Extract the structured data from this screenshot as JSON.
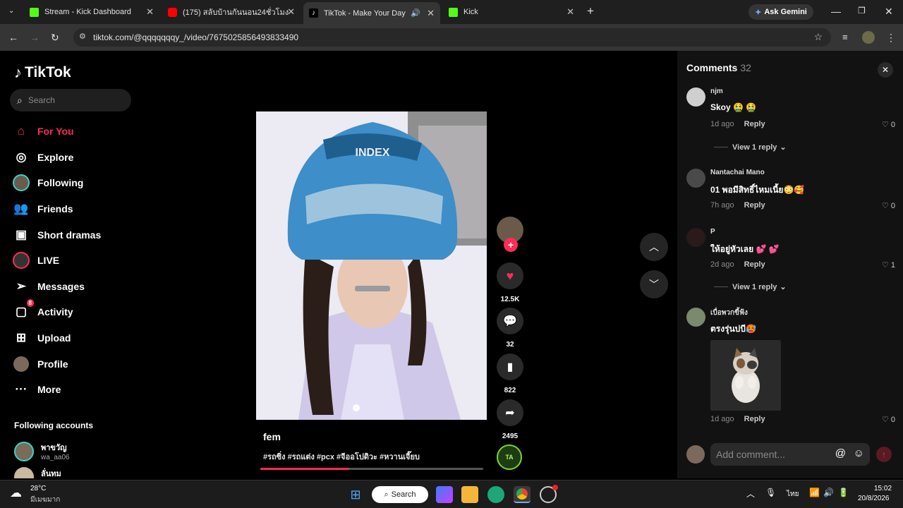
{
  "browser": {
    "tabs": [
      {
        "title": "Stream - Kick Dashboard",
        "favicon": "kick-icon",
        "color": "#53fc18"
      },
      {
        "title": "(175) สลับบ้านกันนอน24ชั่วโมง บ้าน",
        "favicon": "youtube-icon",
        "color": "#ff0000"
      },
      {
        "title": "TikTok - Make Your Day",
        "favicon": "tiktok-icon",
        "color": "#ffffff"
      },
      {
        "title": "Kick",
        "favicon": "kick-icon",
        "color": "#53fc18"
      }
    ],
    "ask_gemini": "Ask Gemini",
    "url": "tiktok.com/@qqqqqqqy_/video/7675025856493833490"
  },
  "sidebar": {
    "logo": "TikTok",
    "search_placeholder": "Search",
    "nav": [
      {
        "label": "For You",
        "icon": "home-icon"
      },
      {
        "label": "Explore",
        "icon": "compass-icon"
      },
      {
        "label": "Following",
        "icon": "following-avatar-icon"
      },
      {
        "label": "Friends",
        "icon": "friends-icon"
      },
      {
        "label": "Short dramas",
        "icon": "short-dramas-icon"
      },
      {
        "label": "LIVE",
        "icon": "live-icon"
      },
      {
        "label": "Messages",
        "icon": "messages-icon"
      },
      {
        "label": "Activity",
        "icon": "activity-icon",
        "badge": "8"
      },
      {
        "label": "Upload",
        "icon": "upload-icon"
      },
      {
        "label": "Profile",
        "icon": "profile-avatar-icon"
      },
      {
        "label": "More",
        "icon": "more-icon"
      }
    ],
    "following_title": "Following accounts",
    "following": [
      {
        "name": "พาขวัญ",
        "handle": "wa_aa06"
      },
      {
        "name": "ลั่นทม",
        "handle": ""
      }
    ]
  },
  "video": {
    "caption": "fem",
    "tags": "#รถซิ่ง #รถแต่ง #pcx #จีออโปดิวะ #หวานเจี๊ยบ",
    "progress": 0.4,
    "helmet_text": "INDEX",
    "likes": "12.5K",
    "comments": "32",
    "saves": "822",
    "shares": "2495"
  },
  "comments_panel": {
    "title": "Comments",
    "count": "32",
    "items": [
      {
        "user": "njm",
        "text": "Skoy 🤮 🤮",
        "time": "1d ago",
        "reply": "Reply",
        "likes": "0",
        "view_replies": "View 1 reply"
      },
      {
        "user": "Nantachai Mano",
        "text": "01 พอมีสิทธิ์ไหมเนี้ย😳🥰",
        "time": "7h ago",
        "reply": "Reply",
        "likes": "0"
      },
      {
        "user": "P",
        "text": "ให้อยู่หัวเลย 💕 💕",
        "time": "2d ago",
        "reply": "Reply",
        "likes": "1",
        "view_replies": "View 1 reply"
      },
      {
        "user": "เบื่อพวกขี้ฟ้ง",
        "text": "ตรงรุ่นบ่บี🥵",
        "time": "1d ago",
        "reply": "Reply",
        "likes": "0"
      }
    ],
    "input_placeholder": "Add comment..."
  },
  "taskbar": {
    "weather_temp": "28°C",
    "weather_desc": "มีเมฆมาก",
    "search_label": "Search",
    "lang": "ไทย",
    "time": "15:02",
    "date": "20/8/2026"
  }
}
